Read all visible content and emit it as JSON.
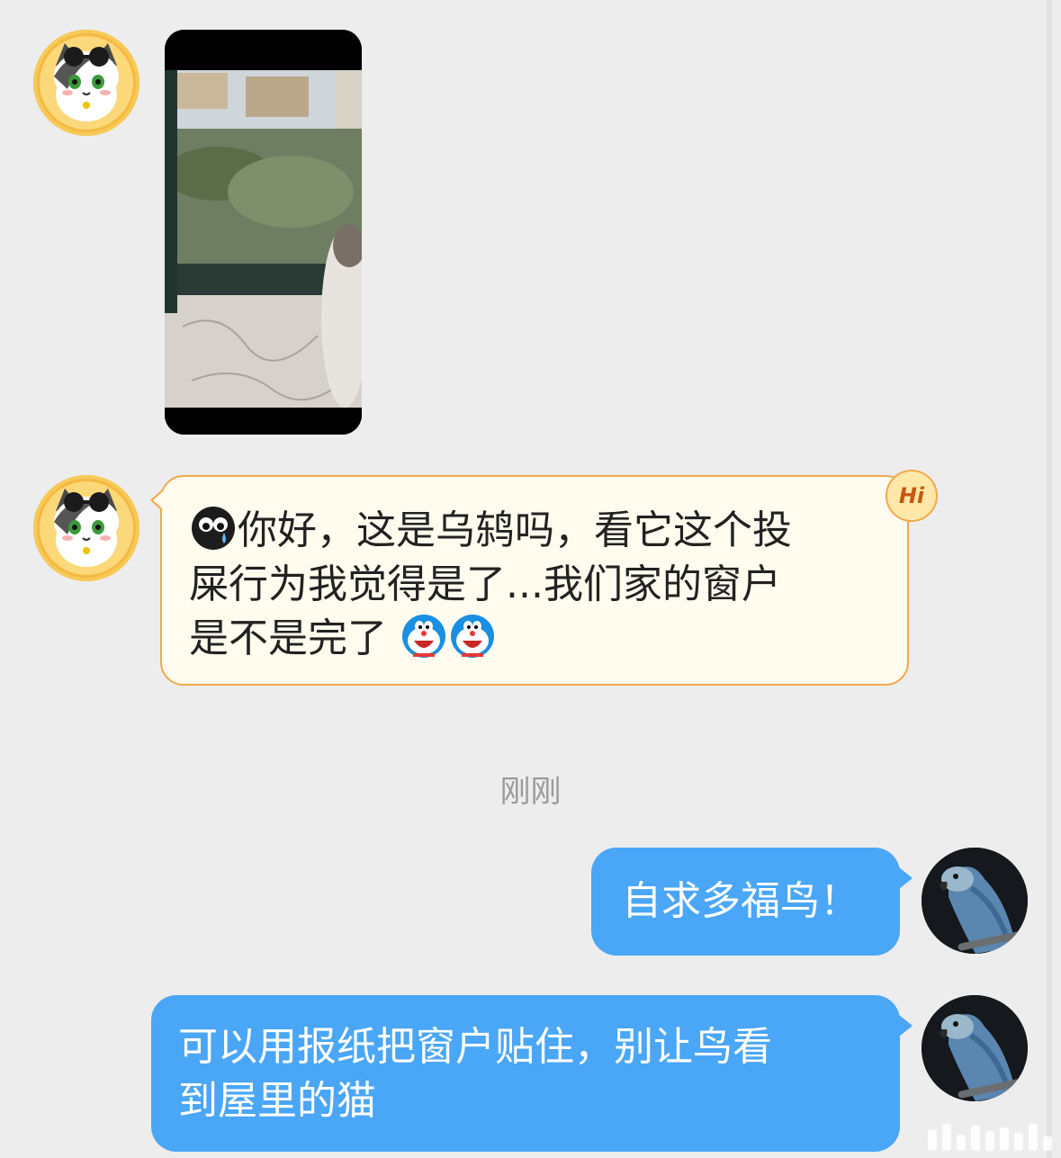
{
  "messages": [
    {
      "sender": "other",
      "type": "video",
      "avatar_icon": "cat-sunglasses-avatar"
    },
    {
      "sender": "other",
      "type": "text",
      "lead_icon": "crying-black-face-emoji",
      "text_line1": "你好，这是乌鸫吗，看它这个投",
      "text_line2": "屎行为我觉得是了...我们家的窗户",
      "text_line3": "是不是完了",
      "trail_icons": [
        "doraemon-emoji",
        "doraemon-emoji"
      ],
      "badge": "Hi"
    },
    {
      "sender": "system",
      "type": "timestamp",
      "text": "刚刚"
    },
    {
      "sender": "me",
      "type": "text",
      "text": "自求多福鸟！",
      "avatar_icon": "parrot-avatar"
    },
    {
      "sender": "me",
      "type": "text",
      "text_line1": "可以用报纸把窗户贴住，别让鸟看",
      "text_line2": "到屋里的猫",
      "avatar_icon": "parrot-avatar"
    }
  ],
  "colors": {
    "background": "#ededed",
    "incoming_bubble": "#fffcef",
    "incoming_border": "#f0a94a",
    "outgoing_bubble": "#4aa6f6",
    "timestamp_text": "#9a9a9a"
  }
}
